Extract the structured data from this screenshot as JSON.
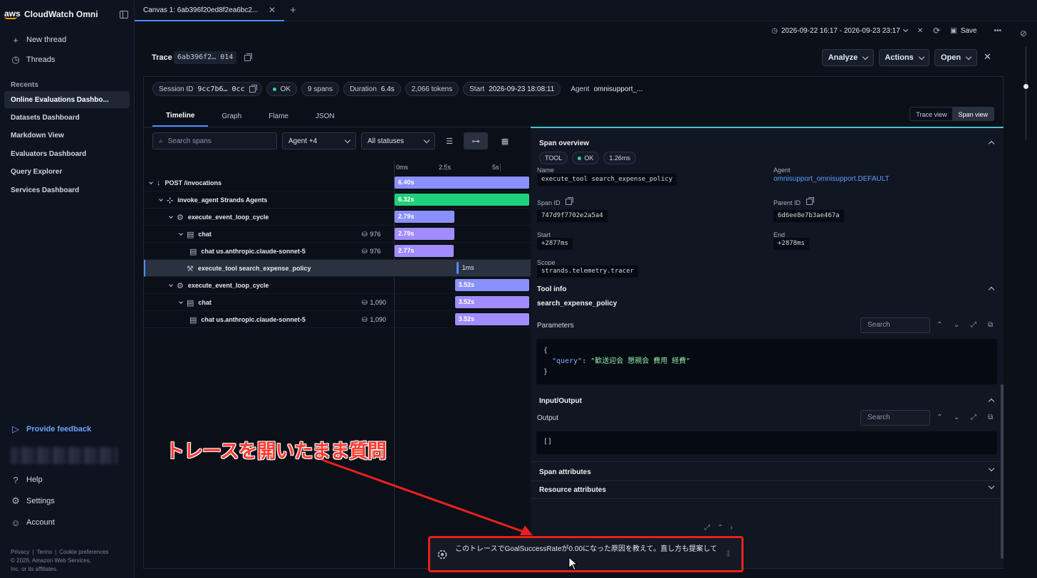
{
  "sidebar": {
    "app_name": "CloudWatch Omni",
    "logo_text": "aws",
    "new_thread": "New thread",
    "threads": "Threads",
    "recents_label": "Recents",
    "recents": [
      "Online Evaluations Dashbo...",
      "Datasets Dashboard",
      "Markdown View",
      "Evaluators Dashboard",
      "Query Explorer",
      "Services Dashboard"
    ],
    "feedback": "Provide feedback",
    "help": "Help",
    "settings": "Settings",
    "account": "Account",
    "legal": {
      "privacy": "Privacy",
      "terms": "Terms",
      "cookie": "Cookie preferences",
      "copyright_line1": "© 2026, Amazon Web Services,",
      "copyright_line2": "Inc. or its affiliates."
    }
  },
  "tabs": {
    "canvas_tab": "Canvas 1: 6ab396f20ed8f2ea6bc2..."
  },
  "toolbar": {
    "time_range": "2026-09-22 16:17 - 2026-09-23 23:17",
    "save": "Save"
  },
  "trace": {
    "label": "Trace",
    "id": "6ab396f2… 014",
    "analyze": "Analyze",
    "actions": "Actions",
    "open": "Open"
  },
  "session": {
    "session_id_label": "Session ID",
    "session_id": "9cc7b6… 0cc",
    "status": "OK",
    "spans": "9 spans",
    "duration_label": "Duration",
    "duration": "6.4s",
    "tokens": "2,066 tokens",
    "start_label": "Start",
    "start": "2026-09-23 18:08:11",
    "agent_label": "Agent",
    "agent": "omnisupport_..."
  },
  "view_tabs": [
    "Timeline",
    "Graph",
    "Flame",
    "JSON"
  ],
  "view_toggle": {
    "trace_view": "Trace view",
    "span_view": "Span view"
  },
  "filters": {
    "search_placeholder": "Search spans",
    "agent": "Agent +4",
    "status": "All statuses"
  },
  "axis_ticks": [
    "0ms",
    "2.5s",
    "5s"
  ],
  "spans": [
    {
      "name": "POST /invocations",
      "tokens": "",
      "duration": "6.40s",
      "start_s": 0.0,
      "dur_s": 6.4,
      "color": "#8b90ff"
    },
    {
      "name": "invoke_agent Strands Agents",
      "tokens": "",
      "duration": "6.32s",
      "start_s": 0.0,
      "dur_s": 6.32,
      "color": "#1fd17a"
    },
    {
      "name": "execute_event_loop_cycle",
      "tokens": "",
      "duration": "2.79s",
      "start_s": 0.0,
      "dur_s": 2.79,
      "color": "#8b90ff"
    },
    {
      "name": "chat",
      "tokens": "976",
      "duration": "2.79s",
      "start_s": 0.0,
      "dur_s": 2.79,
      "color": "#a08cff"
    },
    {
      "name": "chat us.anthropic.claude-sonnet-5",
      "tokens": "976",
      "duration": "2.77s",
      "start_s": 0.0,
      "dur_s": 2.77,
      "color": "#a08cff"
    },
    {
      "name": "execute_tool search_expense_policy",
      "tokens": "",
      "duration": "1ms",
      "start_s": 2.82,
      "dur_s": 0.001,
      "color": "#4c8dff"
    },
    {
      "name": "execute_event_loop_cycle",
      "tokens": "",
      "duration": "3.52s",
      "start_s": 2.82,
      "dur_s": 3.52,
      "color": "#8b90ff"
    },
    {
      "name": "chat",
      "tokens": "1,090",
      "duration": "3.52s",
      "start_s": 2.82,
      "dur_s": 3.52,
      "color": "#a08cff"
    },
    {
      "name": "chat us.anthropic.claude-sonnet-5",
      "tokens": "1,090",
      "duration": "3.52s",
      "start_s": 2.82,
      "dur_s": 3.52,
      "color": "#a08cff"
    }
  ],
  "detail": {
    "overview_title": "Span overview",
    "kind": "TOOL",
    "status": "OK",
    "latency": "1.26ms",
    "name_label": "Name",
    "name": "execute_tool search_expense_policy",
    "agent_label": "Agent",
    "agent": "omnisupport_omnisupport.DEFAULT",
    "span_id_label": "Span ID",
    "span_id": "747d9f7702e2a5a4",
    "parent_id_label": "Parent ID",
    "parent_id": "6d6ee8e7b3ae467a",
    "start_label": "Start",
    "start": "+2877ms",
    "end_label": "End",
    "end": "+2878ms",
    "scope_label": "Scope",
    "scope": "strands.telemetry.tracer",
    "tool_info_title": "Tool info",
    "tool_name": "search_expense_policy",
    "parameters_label": "Parameters",
    "search_placeholder": "Search",
    "param_open": "{",
    "param_key": "\"query\"",
    "param_colon": ": ",
    "param_value": "\"歓送迎会 懇親会 費用 経費\"",
    "param_close": "}",
    "io_title": "Input/Output",
    "output_label": "Output",
    "output_value": "[]",
    "span_attrs": "Span attributes",
    "resource_attrs": "Resource attributes"
  },
  "annotation": {
    "caption": "トレースを開いたまま質問"
  },
  "chat": {
    "input_text": "このトレースでGoalSuccessRateが0.00になった原因を教えて。直し方も提案して",
    "highlight_color": "#e8211e"
  }
}
